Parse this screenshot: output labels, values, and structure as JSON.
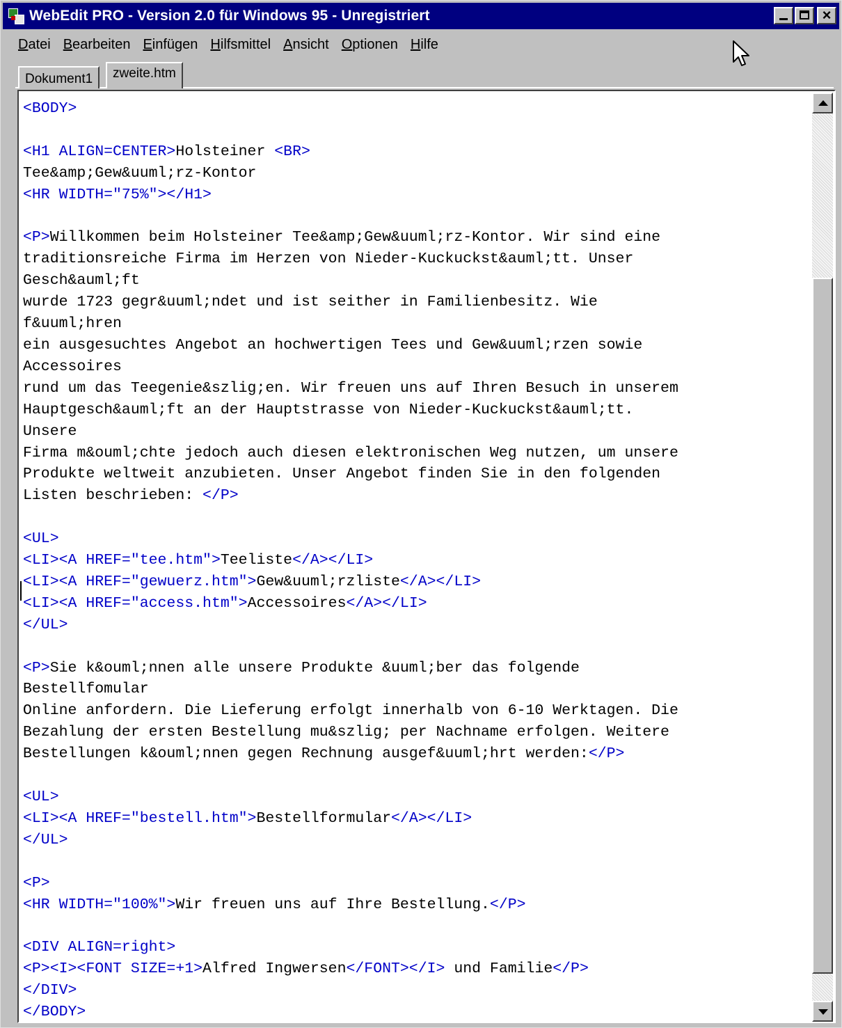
{
  "window": {
    "title": "WebEdit PRO - Version 2.0 für Windows 95 - Unregistriert",
    "app_icon": "webedit-app-icon",
    "controls": {
      "minimize": "minimize-icon",
      "maximize": "maximize-icon",
      "close": "close-icon",
      "close_glyph": "×"
    }
  },
  "menu": [
    {
      "key": "D",
      "rest": "atei"
    },
    {
      "key": "B",
      "rest": "earbeiten"
    },
    {
      "key": "E",
      "rest": "infügen"
    },
    {
      "key": "H",
      "rest": "ilfsmittel"
    },
    {
      "key": "A",
      "rest": "nsicht"
    },
    {
      "key": "O",
      "rest": "ptionen"
    },
    {
      "key": "H",
      "rest": "ilfe"
    }
  ],
  "tabs": [
    {
      "label": "Dokument1",
      "active": false
    },
    {
      "label": "zweite.htm",
      "active": true
    }
  ],
  "editor": {
    "lines": [
      [
        [
          "t",
          "<BODY>"
        ]
      ],
      [],
      [
        [
          "t",
          "<H1 ALIGN=CENTER>"
        ],
        [
          "x",
          "Holsteiner "
        ],
        [
          "t",
          "<BR>"
        ]
      ],
      [
        [
          "x",
          "Tee&amp;Gew&uuml;rz-Kontor"
        ]
      ],
      [
        [
          "t",
          "<HR WIDTH=\"75%\"></H1>"
        ]
      ],
      [],
      [
        [
          "t",
          "<P>"
        ],
        [
          "x",
          "Willkommen beim Holsteiner Tee&amp;Gew&uuml;rz-Kontor. Wir sind eine"
        ]
      ],
      [
        [
          "x",
          "traditionsreiche Firma im Herzen von Nieder-Kuckuckst&auml;tt. Unser"
        ]
      ],
      [
        [
          "x",
          "Gesch&auml;ft"
        ]
      ],
      [
        [
          "x",
          "wurde 1723 gegr&uuml;ndet und ist seither in Familienbesitz. Wie"
        ]
      ],
      [
        [
          "x",
          "f&uuml;hren"
        ]
      ],
      [
        [
          "x",
          "ein ausgesuchtes Angebot an hochwertigen Tees und Gew&uuml;rzen sowie"
        ]
      ],
      [
        [
          "x",
          "Accessoires"
        ]
      ],
      [
        [
          "x",
          "rund um das Teegenie&szlig;en. Wir freuen uns auf Ihren Besuch in unserem"
        ]
      ],
      [
        [
          "x",
          "Hauptgesch&auml;ft an der Hauptstrasse von Nieder-Kuckuckst&auml;tt."
        ]
      ],
      [
        [
          "x",
          "Unsere"
        ]
      ],
      [
        [
          "x",
          "Firma m&ouml;chte jedoch auch diesen elektronischen Weg nutzen, um unsere"
        ]
      ],
      [
        [
          "x",
          "Produkte weltweit anzubieten. Unser Angebot finden Sie in den folgenden"
        ]
      ],
      [
        [
          "x",
          "Listen beschrieben: "
        ],
        [
          "t",
          "</P>"
        ]
      ],
      [],
      [
        [
          "t",
          "<UL>"
        ]
      ],
      [
        [
          "t",
          "<LI><A HREF=\"tee.htm\">"
        ],
        [
          "x",
          "Teeliste"
        ],
        [
          "t",
          "</A></LI>"
        ]
      ],
      [
        [
          "t",
          "<LI><A HREF=\"gewuerz.htm\">"
        ],
        [
          "x",
          "Gew&uuml;rzliste"
        ],
        [
          "t",
          "</A></LI>"
        ]
      ],
      [
        [
          "t",
          "<LI><A HREF=\"access.htm\">"
        ],
        [
          "x",
          "Accessoires"
        ],
        [
          "t",
          "</A></LI>"
        ]
      ],
      [
        [
          "t",
          "</UL>"
        ]
      ],
      [],
      [
        [
          "t",
          "<P>"
        ],
        [
          "x",
          "Sie k&ouml;nnen alle unsere Produkte &uuml;ber das folgende"
        ]
      ],
      [
        [
          "x",
          "Bestellfomular"
        ]
      ],
      [
        [
          "x",
          "Online anfordern. Die Lieferung erfolgt innerhalb von 6-10 Werktagen. Die"
        ]
      ],
      [
        [
          "x",
          "Bezahlung der ersten Bestellung mu&szlig; per Nachname erfolgen. Weitere"
        ]
      ],
      [
        [
          "x",
          "Bestellungen k&ouml;nnen gegen Rechnung ausgef&uuml;hrt werden:"
        ],
        [
          "t",
          "</P>"
        ]
      ],
      [],
      [
        [
          "t",
          "<UL>"
        ]
      ],
      [
        [
          "t",
          "<LI><A HREF=\"bestell.htm\">"
        ],
        [
          "x",
          "Bestellformular"
        ],
        [
          "t",
          "</A></LI>"
        ]
      ],
      [
        [
          "t",
          "</UL>"
        ]
      ],
      [],
      [
        [
          "t",
          "<P>"
        ]
      ],
      [
        [
          "t",
          "<HR WIDTH=\"100%\">"
        ],
        [
          "x",
          "Wir freuen uns auf Ihre Bestellung."
        ],
        [
          "t",
          "</P>"
        ]
      ],
      [],
      [
        [
          "t",
          "<DIV ALIGN=right>"
        ]
      ],
      [
        [
          "t",
          "<P><I><FONT SIZE=+1>"
        ],
        [
          "x",
          "Alfred Ingwersen"
        ],
        [
          "t",
          "</FONT></I>"
        ],
        [
          "x",
          " und Familie"
        ],
        [
          "t",
          "</P>"
        ]
      ],
      [
        [
          "t",
          "</DIV>"
        ]
      ],
      [
        [
          "t",
          "</BODY>"
        ]
      ]
    ],
    "tag_color": "#0000c8",
    "text_color": "#000000"
  },
  "scrollbar": {
    "up": "scroll-up-arrow-icon",
    "down": "scroll-down-arrow-icon"
  },
  "pointer": "mouse-pointer-icon",
  "colors": {
    "titlebar": "#000080",
    "face": "#c0c0c0"
  }
}
